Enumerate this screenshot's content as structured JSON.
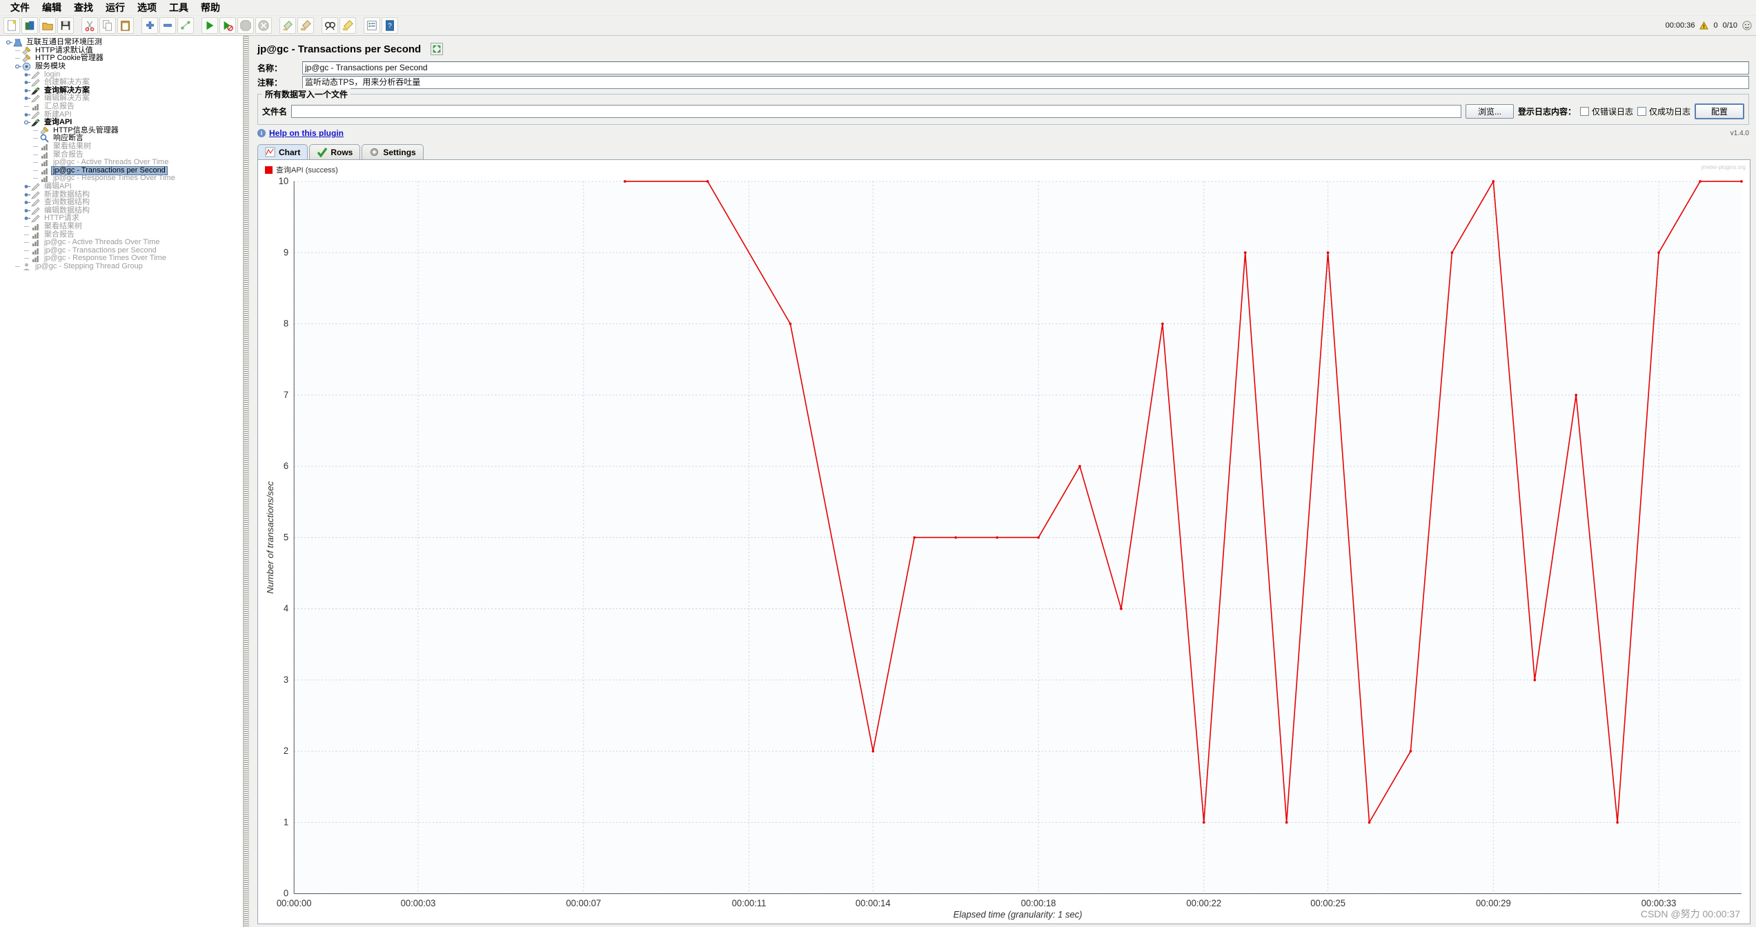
{
  "menubar": {
    "items": [
      {
        "label": "文件",
        "name": "menu-file"
      },
      {
        "label": "编辑",
        "name": "menu-edit"
      },
      {
        "label": "查找",
        "name": "menu-search"
      },
      {
        "label": "运行",
        "name": "menu-run"
      },
      {
        "label": "选项",
        "name": "menu-options"
      },
      {
        "label": "工具",
        "name": "menu-tools"
      },
      {
        "label": "帮助",
        "name": "menu-help"
      }
    ]
  },
  "toolbar": {
    "buttons": [
      {
        "icon": "new-icon",
        "group": 0
      },
      {
        "icon": "templates-icon",
        "group": 0
      },
      {
        "icon": "open-icon",
        "group": 0
      },
      {
        "icon": "save-icon",
        "group": 0
      },
      {
        "icon": "cut-icon",
        "group": 1
      },
      {
        "icon": "copy-icon",
        "group": 1
      },
      {
        "icon": "paste-icon",
        "group": 1
      },
      {
        "icon": "expand-icon",
        "group": 2
      },
      {
        "icon": "collapse-icon",
        "group": 2
      },
      {
        "icon": "toggle-icon",
        "group": 2
      },
      {
        "icon": "start-icon",
        "group": 3
      },
      {
        "icon": "start-no-timers-icon",
        "group": 3
      },
      {
        "icon": "stop-icon",
        "group": 3
      },
      {
        "icon": "shutdown-icon",
        "group": 3
      },
      {
        "icon": "clear-icon",
        "group": 4
      },
      {
        "icon": "clear-all-icon",
        "group": 4
      },
      {
        "icon": "search-icon",
        "group": 5
      },
      {
        "icon": "search-reset-icon",
        "group": 5
      },
      {
        "icon": "function-helper-icon",
        "group": 6
      },
      {
        "icon": "help-icon",
        "group": 6
      }
    ],
    "status": {
      "elapsed": "00:00:36",
      "warning_icon": "warning-triangle-icon",
      "error_count": "0",
      "threads": "0/10",
      "remote_icon": "remote-status-icon"
    }
  },
  "tree": {
    "nodes": [
      {
        "label": "互联互通日常环境压测",
        "depth": 0,
        "icon": "test-plan-icon",
        "handle": "expanded",
        "state": "normal"
      },
      {
        "label": "HTTP请求默认值",
        "depth": 1,
        "icon": "config-element-icon",
        "handle": "none",
        "state": "normal"
      },
      {
        "label": "HTTP Cookie管理器",
        "depth": 1,
        "icon": "config-element-icon",
        "handle": "none",
        "state": "normal"
      },
      {
        "label": "服务模块",
        "depth": 1,
        "icon": "controller-icon",
        "handle": "expanded",
        "state": "normal"
      },
      {
        "label": "login",
        "depth": 2,
        "icon": "sampler-icon",
        "handle": "collapsed",
        "state": "disabled"
      },
      {
        "label": "创建解决方案",
        "depth": 2,
        "icon": "sampler-icon",
        "handle": "collapsed",
        "state": "disabled"
      },
      {
        "label": "查询解决方案",
        "depth": 2,
        "icon": "sampler-active-icon",
        "handle": "collapsed",
        "state": "bold"
      },
      {
        "label": "编辑解决方案",
        "depth": 2,
        "icon": "sampler-icon",
        "handle": "collapsed",
        "state": "disabled"
      },
      {
        "label": "汇总报告",
        "depth": 2,
        "icon": "listener-icon",
        "handle": "none",
        "state": "disabled"
      },
      {
        "label": "新建API",
        "depth": 2,
        "icon": "sampler-icon",
        "handle": "collapsed",
        "state": "disabled"
      },
      {
        "label": "查询API",
        "depth": 2,
        "icon": "sampler-active-icon",
        "handle": "expanded",
        "state": "bold"
      },
      {
        "label": "HTTP信息头管理器",
        "depth": 3,
        "icon": "config-element-icon",
        "handle": "none",
        "state": "normal"
      },
      {
        "label": "响应断言",
        "depth": 3,
        "icon": "assertion-icon",
        "handle": "none",
        "state": "normal"
      },
      {
        "label": "聚看结果树",
        "depth": 3,
        "icon": "listener-icon",
        "handle": "none",
        "state": "disabled"
      },
      {
        "label": "聚合报告",
        "depth": 3,
        "icon": "listener-icon",
        "handle": "none",
        "state": "disabled"
      },
      {
        "label": "jp@gc - Active Threads Over Time",
        "depth": 3,
        "icon": "listener-icon",
        "handle": "none",
        "state": "disabled"
      },
      {
        "label": "jp@gc - Transactions per Second",
        "depth": 3,
        "icon": "listener-icon",
        "handle": "none",
        "state": "selected"
      },
      {
        "label": "jp@gc - Response Times Over Time",
        "depth": 3,
        "icon": "listener-icon",
        "handle": "none",
        "state": "disabled"
      },
      {
        "label": "编辑API",
        "depth": 2,
        "icon": "sampler-icon",
        "handle": "collapsed",
        "state": "disabled"
      },
      {
        "label": "新建数据结构",
        "depth": 2,
        "icon": "sampler-icon",
        "handle": "collapsed",
        "state": "disabled"
      },
      {
        "label": "查询数据结构",
        "depth": 2,
        "icon": "sampler-icon",
        "handle": "collapsed",
        "state": "disabled"
      },
      {
        "label": "编辑数据结构",
        "depth": 2,
        "icon": "sampler-icon",
        "handle": "collapsed",
        "state": "disabled"
      },
      {
        "label": "HTTP请求",
        "depth": 2,
        "icon": "sampler-icon",
        "handle": "collapsed",
        "state": "disabled"
      },
      {
        "label": "聚看结果树",
        "depth": 2,
        "icon": "listener-icon",
        "handle": "none",
        "state": "disabled"
      },
      {
        "label": "聚合报告",
        "depth": 2,
        "icon": "listener-icon",
        "handle": "none",
        "state": "disabled"
      },
      {
        "label": "jp@gc - Active Threads Over Time",
        "depth": 2,
        "icon": "listener-icon",
        "handle": "none",
        "state": "disabled"
      },
      {
        "label": "jp@gc - Transactions per Second",
        "depth": 2,
        "icon": "listener-icon",
        "handle": "none",
        "state": "disabled"
      },
      {
        "label": "jp@gc - Response Times Over Time",
        "depth": 2,
        "icon": "listener-icon",
        "handle": "none",
        "state": "disabled"
      },
      {
        "label": "jp@gc - Stepping Thread Group",
        "depth": 1,
        "icon": "thread-group-icon",
        "handle": "none",
        "state": "disabled"
      }
    ]
  },
  "panel": {
    "title": "jp@gc - Transactions per Second",
    "expand_icon": "expand-arrows-icon",
    "name_label": "名称：",
    "name_value": "jp@gc - Transactions per Second",
    "comment_label": "注释：",
    "comment_value": "监听动态TPS，用来分析吞吐量",
    "group_title": "所有数据写入一个文件",
    "filename_label": "文件名",
    "filename_value": "",
    "browse_button": "浏览...",
    "log_content_label": "登示日志内容：",
    "checkbox_errors": "仅错误日志",
    "checkbox_success": "仅成功日志",
    "config_button": "配置",
    "help_link": "Help on this plugin",
    "info_icon": "info-icon",
    "version": "v1.4.0"
  },
  "tabs": [
    {
      "label": "Chart",
      "icon": "chart-icon",
      "active": true
    },
    {
      "label": "Rows",
      "icon": "check-icon",
      "active": false
    },
    {
      "label": "Settings",
      "icon": "gear-icon",
      "active": false
    }
  ],
  "chart_watermark": "jmeter-plugins.org",
  "footer_watermark": "CSDN @努力 00:00:37",
  "chart_data": {
    "type": "line",
    "title": "",
    "xlabel": "Elapsed time (granularity: 1 sec)",
    "ylabel": "Number of transactions/sec",
    "legend": [
      {
        "name": "查询API (success)",
        "color": "#e60000"
      }
    ],
    "legend_position": "top-left",
    "grid": true,
    "xlim": [
      0,
      35
    ],
    "ylim": [
      0,
      10
    ],
    "yticks": [
      0,
      1,
      2,
      3,
      4,
      5,
      6,
      7,
      8,
      9,
      10
    ],
    "xticks": [
      0,
      3,
      7,
      11,
      14,
      18,
      22,
      25,
      29,
      33
    ],
    "xtick_labels": [
      "00:00:00",
      "00:00:03",
      "00:00:07",
      "00:00:11",
      "00:00:14",
      "00:00:18",
      "00:00:22",
      "00:00:25",
      "00:00:29",
      "00:00:33"
    ],
    "series": [
      {
        "name": "查询API (success)",
        "color": "#e60000",
        "x": [
          8,
          10,
          12,
          14,
          15,
          16,
          17,
          18,
          19,
          20,
          21,
          22,
          23,
          24,
          25,
          26,
          27,
          28,
          29,
          30,
          31,
          32,
          33,
          34,
          35
        ],
        "values": [
          10,
          10,
          8,
          2,
          5,
          5,
          5,
          5,
          6,
          4,
          8,
          1,
          9,
          1,
          9,
          1,
          2,
          9,
          10,
          3,
          7,
          1,
          9,
          10,
          10
        ]
      }
    ]
  }
}
